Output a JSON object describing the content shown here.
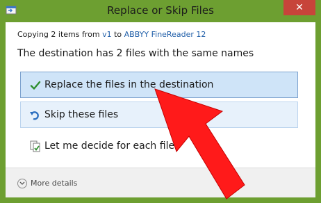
{
  "window": {
    "title": "Replace or Skip Files",
    "close_glyph": "✕"
  },
  "copy": {
    "prefix": "Copying 2 items from",
    "source": "v1",
    "middle": "to",
    "destination": "ABBYY FineReader 12"
  },
  "headline": "The destination has 2 files with the same names",
  "options": [
    {
      "label": "Replace the files in the destination",
      "icon": "checkmark-icon"
    },
    {
      "label": "Skip these files",
      "icon": "skip-arrow-icon"
    },
    {
      "label": "Let me decide for each file",
      "icon": "decide-files-icon"
    }
  ],
  "footer": {
    "more_details": "More details"
  },
  "colors": {
    "accent": "#6d9f31",
    "selection": "#cfe4f8",
    "link": "#1f5ea8",
    "arrow": "#ff1a1a"
  }
}
